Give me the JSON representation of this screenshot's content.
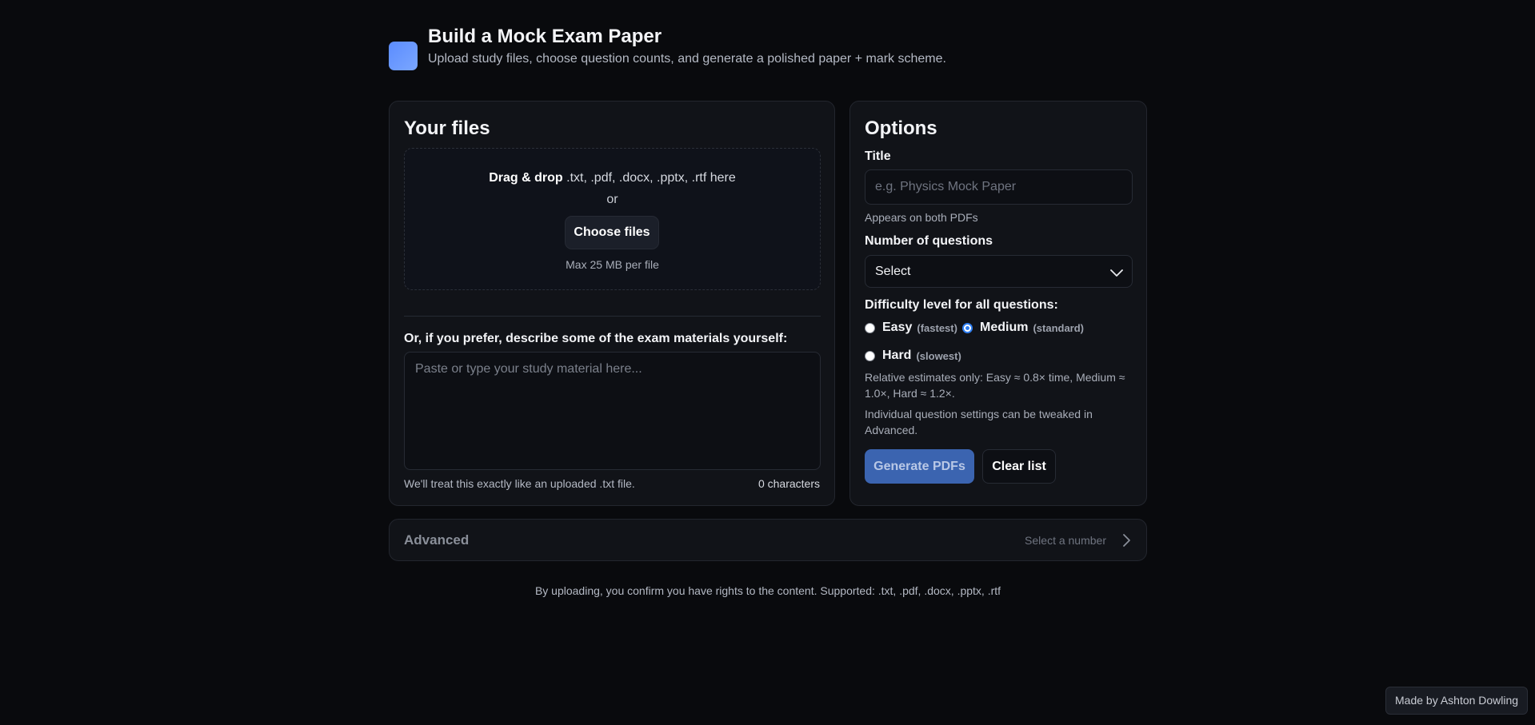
{
  "header": {
    "title": "Build a Mock Exam Paper",
    "subtitle": "Upload study files, choose question counts, and generate a polished paper + mark scheme."
  },
  "files": {
    "title": "Your files",
    "dropzone": {
      "bold": "Drag & drop",
      "types": " .txt, .pdf, .docx, .pptx, .rtf here",
      "or": "or",
      "choose_label": "Choose files",
      "max": "Max 25 MB per file"
    },
    "describe": {
      "label": "Or, if you prefer, describe some of the exam materials yourself:",
      "placeholder": "Paste or type your study material here...",
      "note": "We'll treat this exactly like an uploaded .txt file.",
      "count": "0 characters"
    }
  },
  "options": {
    "title": "Options",
    "title_field": {
      "label": "Title",
      "placeholder": "e.g. Physics Mock Paper",
      "helper": "Appears on both PDFs"
    },
    "questions": {
      "label": "Number of questions",
      "selected": "Select"
    },
    "difficulty": {
      "label": "Difficulty level for all questions:",
      "levels": [
        {
          "name": "Easy",
          "hint": "(fastest)"
        },
        {
          "name": "Medium",
          "hint": "(standard)"
        },
        {
          "name": "Hard",
          "hint": "(slowest)"
        }
      ],
      "selected": "Medium",
      "note1": "Relative estimates only: Easy ≈ 0.8× time, Medium ≈ 1.0×, Hard ≈ 1.2×.",
      "note2": "Individual question settings can be tweaked in Advanced."
    },
    "generate_label": "Generate PDFs",
    "clear_label": "Clear list"
  },
  "advanced": {
    "title": "Advanced",
    "hint": "Select a number"
  },
  "disclaimer": "By uploading, you confirm you have rights to the content. Supported: .txt, .pdf, .docx, .pptx, .rtf",
  "credit": "Made by Ashton Dowling",
  "colors": {
    "background": "#090a0d",
    "card": "#111318",
    "accent": "#5b8cff",
    "primary_button": "#3b64b0",
    "radio_checked": "#2f7ff2"
  }
}
